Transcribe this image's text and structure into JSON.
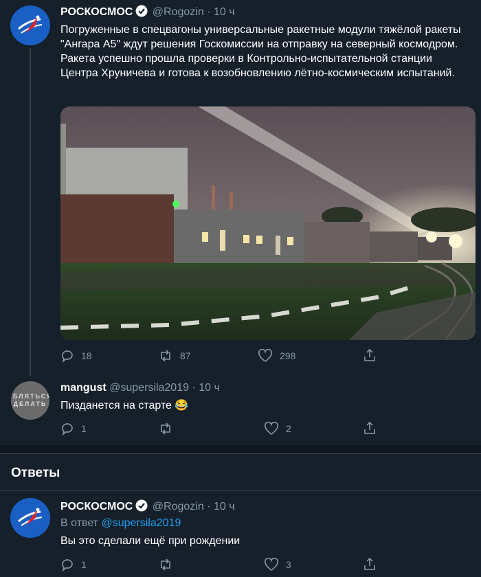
{
  "tweet_main": {
    "author_name": "РОСКОСМОС",
    "handle": "@Rogozin",
    "time": "· 10 ч",
    "text": "Погруженные в спецвагоны универсальные ракетные модули тяжёлой ракеты \"Ангара А5\" ждут решения Госкомиссии на отправку на северный космодром. Ракета  успешно прошла проверки в Контрольно-испытательной станции Центра Хруничева и готова к возобновлению лётно-космическим испытаний.",
    "actions": {
      "replies": "18",
      "retweets": "87",
      "likes": "298"
    }
  },
  "tweet_reply": {
    "author_name": "mangust",
    "handle": "@supersila2019",
    "time": "· 10 ч",
    "text": "Пизданется на старте 😂",
    "avatar_text": "БЛЯТЬСЯ ДЕЛАТЬ",
    "actions": {
      "replies": "1",
      "retweets": "",
      "likes": "2"
    }
  },
  "replies_section": {
    "title": "Ответы"
  },
  "tweet_answer": {
    "author_name": "РОСКОСМОС",
    "handle": "@Rogozin",
    "time": "· 10 ч",
    "reply_to_prefix": "В ответ",
    "reply_to_handle": "@supersila2019",
    "text": "Вы это сделали ещё при рождении",
    "actions": {
      "replies": "1",
      "retweets": "",
      "likes": "3"
    }
  },
  "colors": {
    "background": "#15202b",
    "secondary_text": "#8899a6",
    "link": "#1da1f2",
    "brand_blue": "#1a5fc4",
    "divider": "#38444d"
  }
}
